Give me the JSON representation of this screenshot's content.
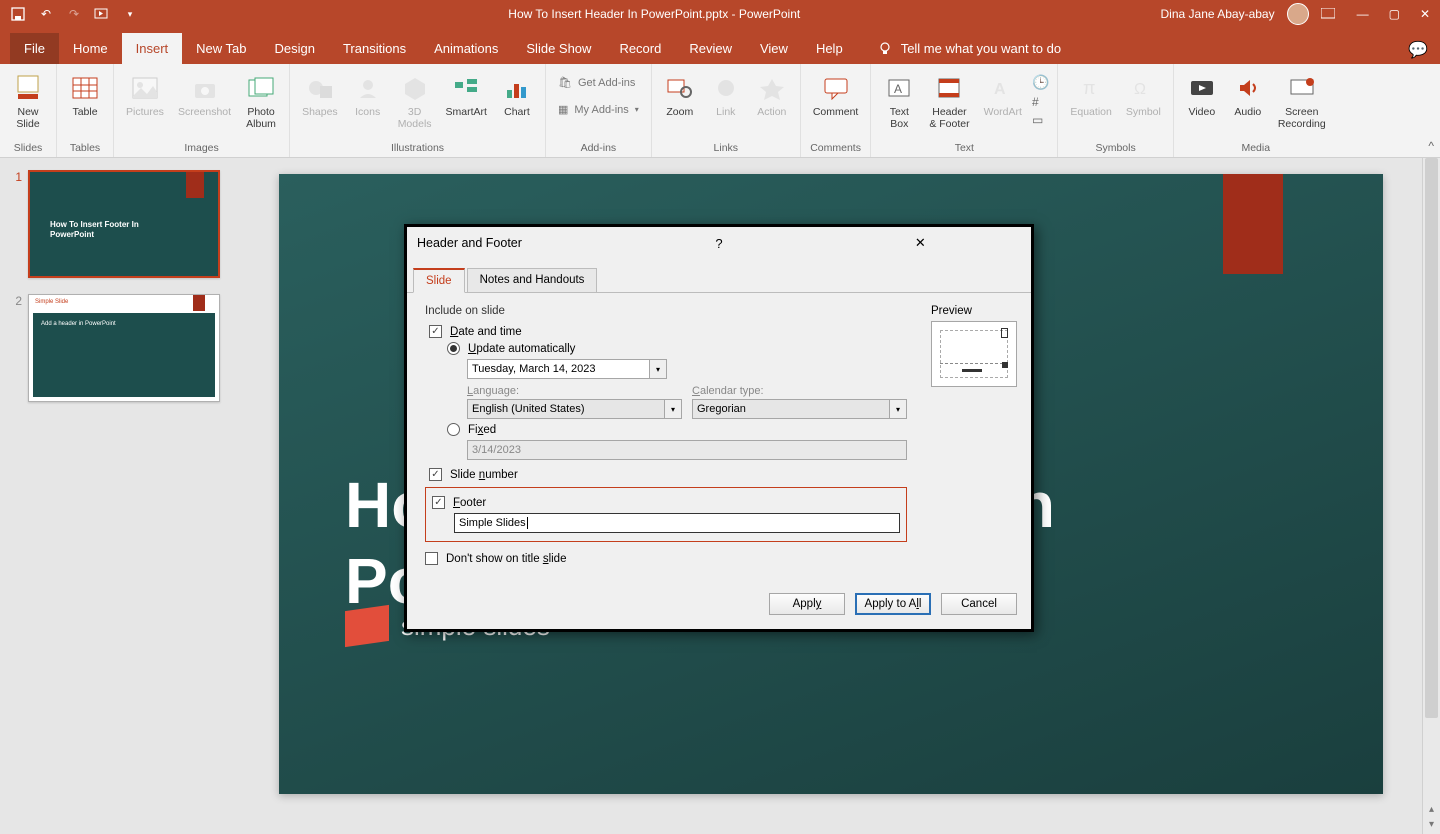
{
  "titlebar": {
    "document_title": "How To Insert Header In PowerPoint.pptx  -  PowerPoint",
    "user_name": "Dina Jane Abay-abay"
  },
  "menu": {
    "file": "File",
    "home": "Home",
    "insert": "Insert",
    "new_tab": "New Tab",
    "design": "Design",
    "transitions": "Transitions",
    "animations": "Animations",
    "slide_show": "Slide Show",
    "record": "Record",
    "review": "Review",
    "view": "View",
    "help": "Help",
    "tell_me": "Tell me what you want to do"
  },
  "ribbon": {
    "slides": {
      "new_slide": "New\nSlide",
      "group": "Slides"
    },
    "tables": {
      "table": "Table",
      "group": "Tables"
    },
    "images": {
      "pictures": "Pictures",
      "screenshot": "Screenshot",
      "photo_album": "Photo\nAlbum",
      "group": "Images"
    },
    "illustrations": {
      "shapes": "Shapes",
      "icons": "Icons",
      "models": "3D\nModels",
      "smartart": "SmartArt",
      "chart": "Chart",
      "group": "Illustrations"
    },
    "addins": {
      "get": "Get Add-ins",
      "my": "My Add-ins",
      "group": "Add-ins"
    },
    "links": {
      "zoom": "Zoom",
      "link": "Link",
      "action": "Action",
      "group": "Links"
    },
    "comments": {
      "comment": "Comment",
      "group": "Comments"
    },
    "text": {
      "text_box": "Text\nBox",
      "header_footer": "Header\n& Footer",
      "wordart": "WordArt",
      "group": "Text"
    },
    "symbols": {
      "equation": "Equation",
      "symbol": "Symbol",
      "group": "Symbols"
    },
    "media": {
      "video": "Video",
      "audio": "Audio",
      "screen_recording": "Screen\nRecording",
      "group": "Media"
    }
  },
  "thumbs": {
    "n1": "1",
    "n2": "2",
    "t1_line1": "How To Insert Footer In",
    "t1_line2": "PowerPoint",
    "t2_title": "Simple Slide",
    "t2_text": "Add a header in PowerPoint"
  },
  "slide": {
    "title": "How To Insert Footer In\nPowerPoint",
    "brand": "simple slides"
  },
  "dialog": {
    "title": "Header and Footer",
    "tab_slide": "Slide",
    "tab_notes": "Notes and Handouts",
    "include_on_slide": "Include on slide",
    "date_time": "Date and time",
    "update_auto": "Update automatically",
    "date_value": "Tuesday, March 14, 2023",
    "language_lbl": "Language:",
    "language_val": "English (United States)",
    "calendar_lbl": "Calendar type:",
    "calendar_val": "Gregorian",
    "fixed": "Fixed",
    "fixed_val": "3/14/2023",
    "slide_number": "Slide number",
    "footer": "Footer",
    "footer_val": "Simple Slides",
    "dont_show": "Don't show on title slide",
    "preview": "Preview",
    "apply": "Apply",
    "apply_all": "Apply to All",
    "cancel": "Cancel"
  }
}
